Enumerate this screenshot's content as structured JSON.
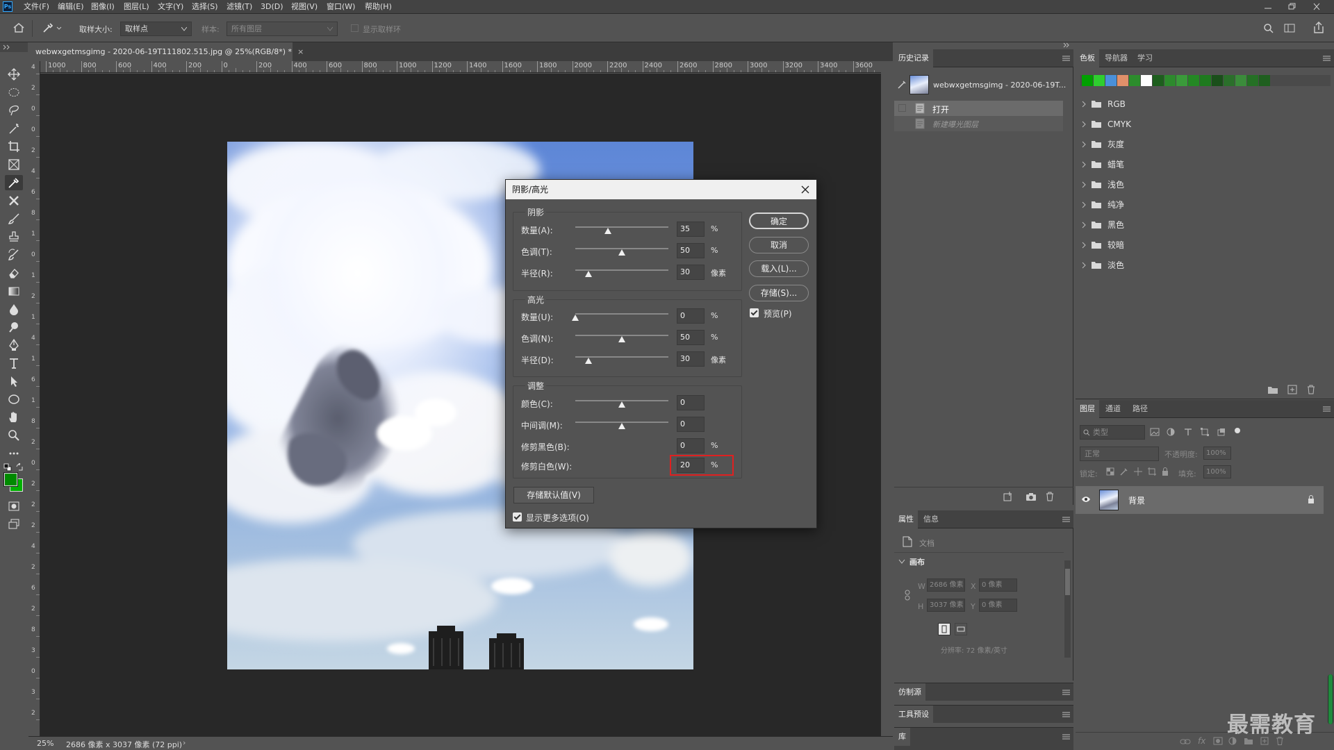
{
  "app": {
    "logo": "Ps",
    "window_controls": [
      "minimize-icon",
      "restore-icon",
      "close-icon"
    ]
  },
  "menu": {
    "items": [
      "文件(F)",
      "编辑(E)",
      "图像(I)",
      "图层(L)",
      "文字(Y)",
      "选择(S)",
      "滤镜(T)",
      "3D(D)",
      "视图(V)",
      "窗口(W)",
      "帮助(H)"
    ]
  },
  "options": {
    "sample_size_label": "取样大小:",
    "sample_size_value": "取样点",
    "sample_label": "样本:",
    "sample_value": "所有图层",
    "show_ring_label": "显示取样环"
  },
  "document": {
    "tab_title": "webwxgetmsgimg - 2020-06-19T111802.515.jpg @ 25%(RGB/8*) *",
    "tab_close": "×"
  },
  "ruler": {
    "h_ticks": [
      "1000",
      "800",
      "600",
      "400",
      "200",
      "0",
      "200",
      "400",
      "600",
      "800",
      "1000",
      "1200",
      "1400",
      "1600",
      "1800",
      "2000",
      "2200",
      "2400",
      "2600",
      "2800",
      "3000",
      "3200",
      "3400",
      "3600"
    ],
    "v_ticks": [
      "4",
      "2",
      "0",
      "0",
      "2",
      "4",
      "6",
      "8",
      "1",
      "0",
      "1",
      "2",
      "1",
      "4",
      "1",
      "6",
      "1",
      "8",
      "2",
      "0",
      "2",
      "2",
      "2",
      "4",
      "2",
      "6",
      "2",
      "8",
      "3",
      "0",
      "3",
      "2"
    ]
  },
  "status": {
    "zoom": "25%",
    "doc_info": "2686 像素 x 3037 像素 (72 ppi)"
  },
  "history": {
    "tab": "历史记录",
    "snapshot_name": "webwxgetmsgimg - 2020-06-19T...",
    "items": [
      {
        "label": "打开",
        "active": true
      },
      {
        "label": "新建曝光图层",
        "active": false
      }
    ]
  },
  "swatches": {
    "tabs": [
      "色板",
      "导航器",
      "学习"
    ],
    "colors": [
      "#00a000",
      "#2fce2f",
      "#4a90d9",
      "#e0906a",
      "#2c8c2c",
      "#ffffff",
      "#1d5e1d",
      "#2d8a2d",
      "#3a9a3a",
      "#248824",
      "#1e7a1e",
      "#1a4f1a",
      "#2b6f2b",
      "#3b8c3b",
      "#257025",
      "#1f5f1f"
    ],
    "groups": [
      "RGB",
      "CMYK",
      "灰度",
      "蜡笔",
      "浅色",
      "纯净",
      "黑色",
      "较暗",
      "淡色"
    ]
  },
  "properties": {
    "tabs": [
      "属性",
      "信息"
    ],
    "doc_label": "文档",
    "canvas_label": "画布",
    "w_label": "W",
    "w_value": "2686 像素",
    "h_label": "H",
    "h_value": "3037 像素",
    "x_label": "X",
    "x_value": "0 像素",
    "y_label": "Y",
    "y_value": "0 像素",
    "resolution": "分辨率: 72 像素/英寸"
  },
  "collapsed_panels": [
    "仿制源",
    "工具预设",
    "库"
  ],
  "layers": {
    "tabs": [
      "图层",
      "通道",
      "路径"
    ],
    "search_placeholder": "类型",
    "blend_mode": "正常",
    "opacity_label": "不透明度:",
    "opacity_value": "100%",
    "lock_label": "锁定:",
    "fill_label": "填充:",
    "fill_value": "100%",
    "layer_name": "背景"
  },
  "dialog": {
    "title": "阴影/高光",
    "shadows": {
      "title": "阴影",
      "rows": [
        {
          "label": "数量(A):",
          "value": "35",
          "unit": "%",
          "level": 0.35
        },
        {
          "label": "色调(T):",
          "value": "50",
          "unit": "%",
          "level": 0.5
        },
        {
          "label": "半径(R):",
          "value": "30",
          "unit": "像素",
          "level": 0.14
        }
      ]
    },
    "highlights": {
      "title": "高光",
      "rows": [
        {
          "label": "数量(U):",
          "value": "0",
          "unit": "%",
          "level": 0.0
        },
        {
          "label": "色调(N):",
          "value": "50",
          "unit": "%",
          "level": 0.5
        },
        {
          "label": "半径(D):",
          "value": "30",
          "unit": "像素",
          "level": 0.14
        }
      ]
    },
    "adjust": {
      "title": "调整",
      "rows": [
        {
          "label": "颜色(C):",
          "value": "0",
          "unit": "",
          "level": 0.5
        },
        {
          "label": "中间调(M):",
          "value": "0",
          "unit": "",
          "level": 0.5
        },
        {
          "label": "修剪黑色(B):",
          "value": "0",
          "unit": "%"
        },
        {
          "label": "修剪白色(W):",
          "value": "20",
          "unit": "%"
        }
      ]
    },
    "buttons": {
      "ok": "确定",
      "cancel": "取消",
      "load": "载入(L)...",
      "save": "存储(S)...",
      "preview": "预览(P)",
      "save_default": "存储默认值(V)",
      "more_options": "显示更多选项(O)"
    }
  },
  "watermark": "最需教育"
}
